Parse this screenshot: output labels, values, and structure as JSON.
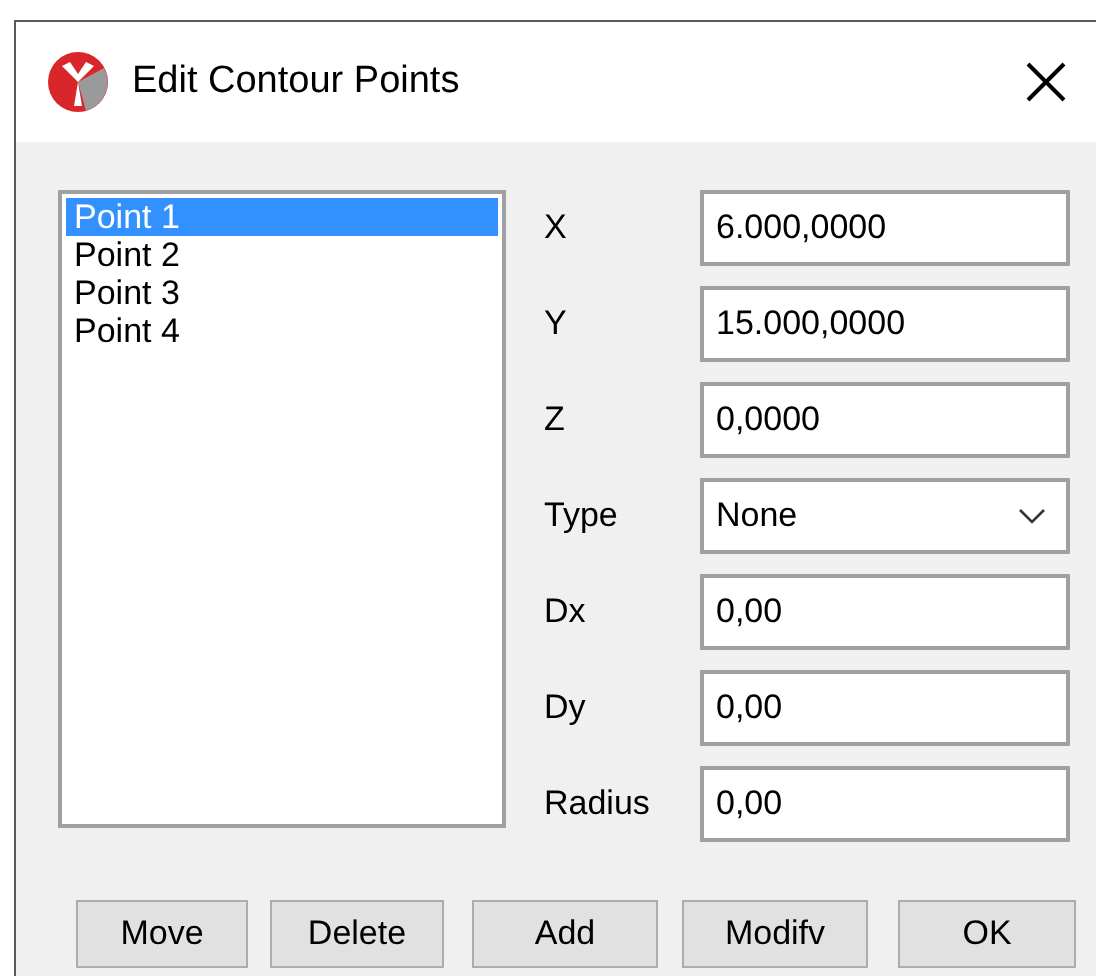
{
  "window": {
    "title": "Edit Contour Points"
  },
  "points": [
    {
      "label": "Point 1",
      "selected": true
    },
    {
      "label": "Point 2",
      "selected": false
    },
    {
      "label": "Point 3",
      "selected": false
    },
    {
      "label": "Point 4",
      "selected": false
    }
  ],
  "fields": [
    {
      "label": "X",
      "value": "6.000,0000",
      "kind": "text"
    },
    {
      "label": "Y",
      "value": "15.000,0000",
      "kind": "text"
    },
    {
      "label": "Z",
      "value": "0,0000",
      "kind": "text"
    },
    {
      "label": "Type",
      "value": "None",
      "kind": "dropdown"
    },
    {
      "label": "Dx",
      "value": "0,00",
      "kind": "text"
    },
    {
      "label": "Dy",
      "value": "0,00",
      "kind": "text"
    },
    {
      "label": "Radius",
      "value": "0,00",
      "kind": "text"
    }
  ],
  "buttons": [
    "Move",
    "Delete",
    "Add",
    "Modifv",
    "OK"
  ]
}
